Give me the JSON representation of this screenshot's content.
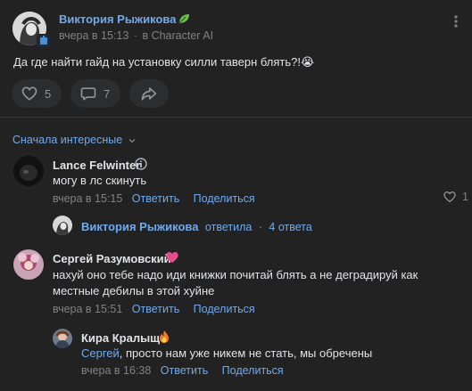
{
  "post": {
    "author": "Виктория Рыжикова",
    "author_badge": "leaf-icon",
    "meta_time": "вчера в 15:13",
    "meta_sep": "·",
    "meta_source": "в Character AI",
    "text": "Да где найти гайд на установку силли таверн блять?!😭",
    "likes": "5",
    "comments": "7"
  },
  "comments": {
    "sort_label": "Сначала интересные",
    "items": [
      {
        "author": "Lance Felwinter",
        "text": "могу в лс скинуть",
        "time": "вчера в 15:15",
        "reply": "Ответить",
        "share": "Поделиться",
        "likes": "1",
        "thread": {
          "author": "Виктория Рыжикова",
          "action": "ответила",
          "sep": "·",
          "count": "4 ответа"
        }
      },
      {
        "author": "Сергей Разумовский",
        "text_line1": "нахуй оно тебе надо иди книжки почитай блять а не деградируй как",
        "text_line2": "местные дебилы в этой хуйне",
        "time": "вчера в 15:51",
        "reply": "Ответить",
        "share": "Поделиться",
        "sub_reply": {
          "author": "Кира Кралыщ",
          "mention": "Сергей",
          "text": ", просто нам уже никем не стать, мы обречены",
          "time": "вчера в 16:38",
          "reply": "Ответить",
          "share": "Поделиться"
        }
      }
    ]
  },
  "colors": {
    "background": "#222222",
    "accent": "#71aaeb",
    "muted": "#828282",
    "heart_badge": "#e64c8c"
  }
}
